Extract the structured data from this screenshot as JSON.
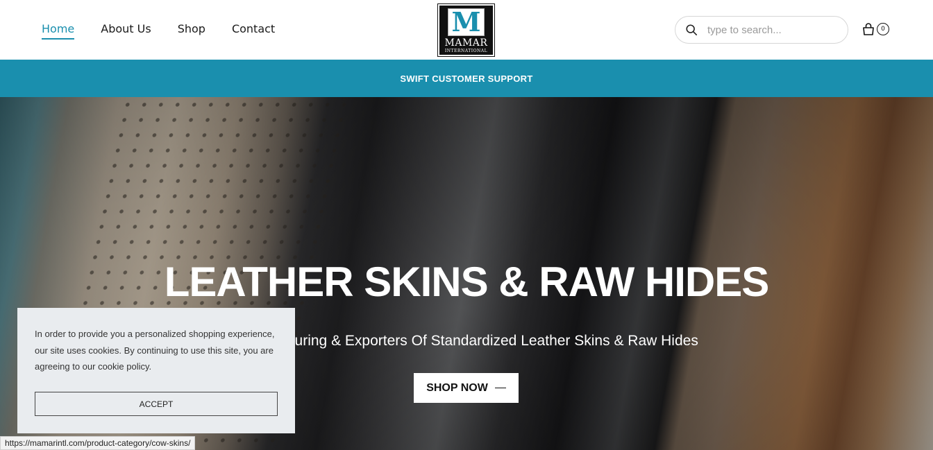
{
  "nav": {
    "items": [
      {
        "label": "Home",
        "active": true
      },
      {
        "label": "About Us",
        "active": false
      },
      {
        "label": "Shop",
        "active": false
      },
      {
        "label": "Contact",
        "active": false
      }
    ]
  },
  "logo": {
    "letter": "M",
    "word": "MAMAR",
    "sub": "INTERNATIONAL"
  },
  "search": {
    "placeholder": "type to search..."
  },
  "cart": {
    "count": "0"
  },
  "banner": {
    "text": "SWIFT CUSTOMER SUPPORT"
  },
  "hero": {
    "title": "LEATHER SKINS & RAW HIDES",
    "subtitle": "Manufacturing & Exporters Of Standardized Leather Skins & Raw Hides",
    "button": "SHOP NOW"
  },
  "cookie": {
    "text": "In order to provide you a personalized shopping experience, our site uses cookies. By continuing to use this site, you are agreeing to our cookie policy.",
    "accept": "ACCEPT"
  },
  "status_url": "https://mamarintl.com/product-category/cow-skins/",
  "colors": {
    "accent": "#1a8fae"
  }
}
